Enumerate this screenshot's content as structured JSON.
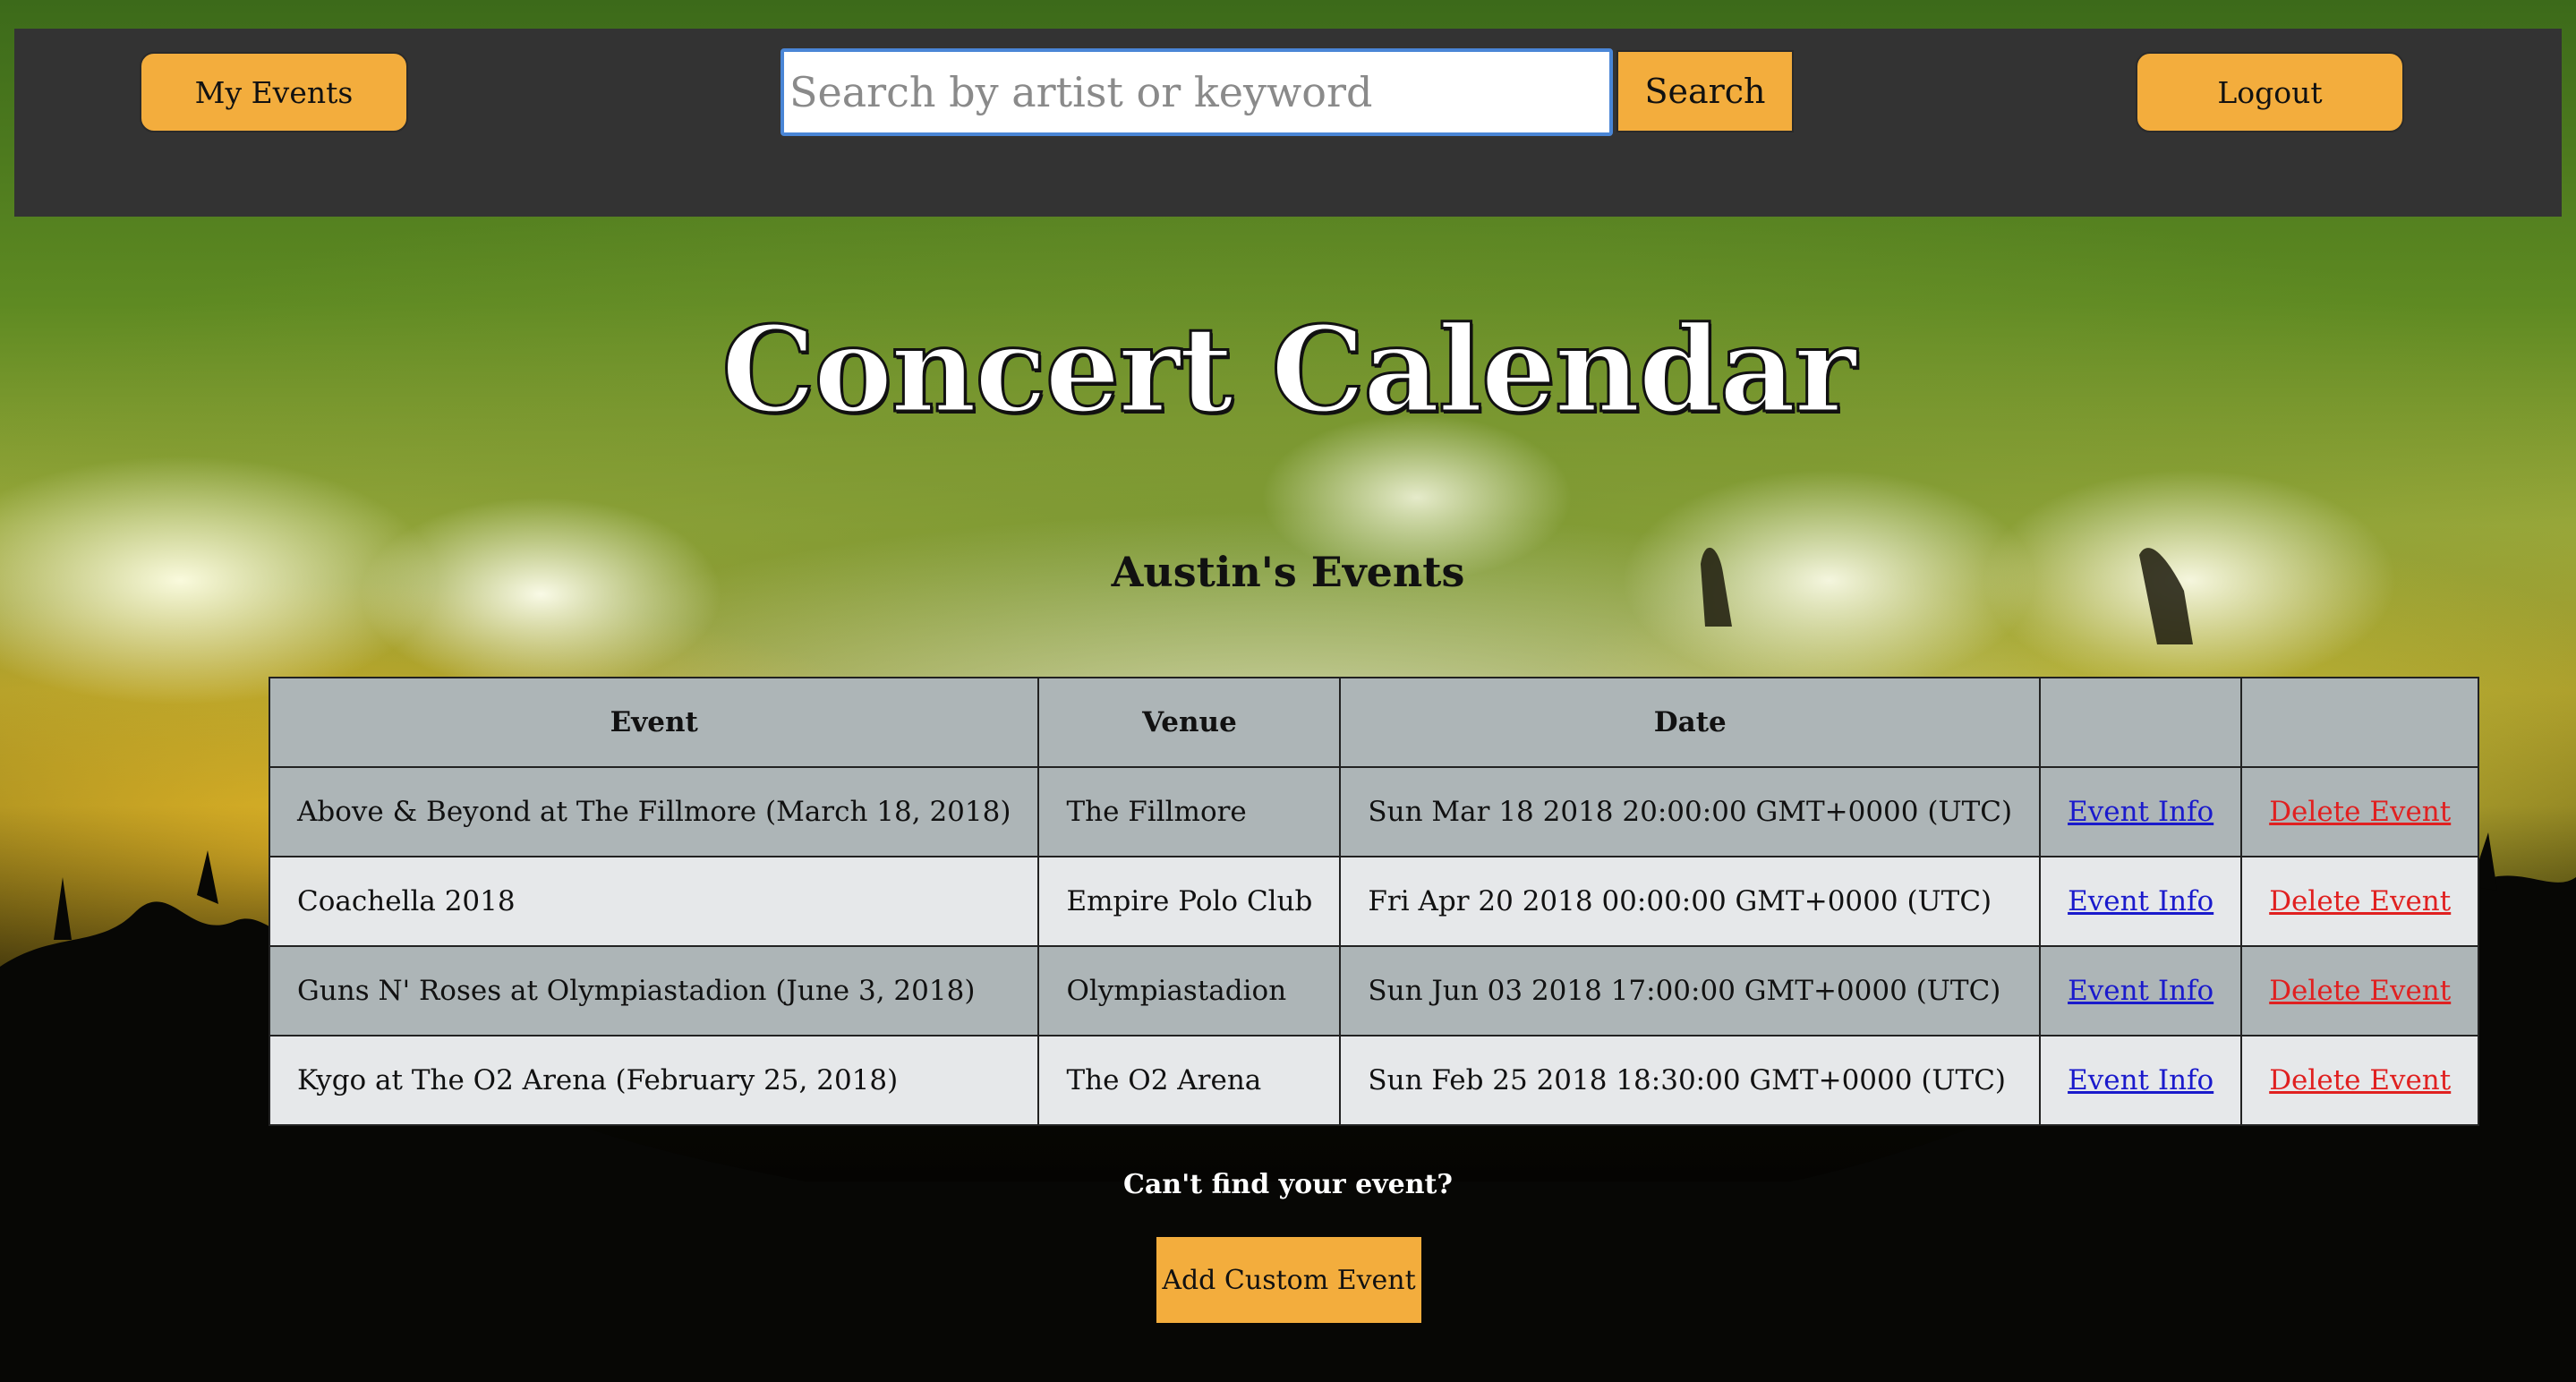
{
  "nav": {
    "my_events_label": "My Events",
    "search_placeholder": "Search by artist or keyword",
    "search_value": "",
    "search_button_label": "Search",
    "logout_label": "Logout"
  },
  "hero": {
    "title": "Concert Calendar",
    "subtitle": "Austin's Events"
  },
  "table": {
    "headers": [
      "Event",
      "Venue",
      "Date",
      "",
      ""
    ],
    "rows": [
      {
        "event": "Above & Beyond at The Fillmore (March 18, 2018)",
        "venue": "The Fillmore",
        "date": "Sun Mar 18 2018 20:00:00 GMT+0000 (UTC)",
        "info_label": "Event Info",
        "delete_label": "Delete Event"
      },
      {
        "event": "Coachella 2018",
        "venue": "Empire Polo Club",
        "date": "Fri Apr 20 2018 00:00:00 GMT+0000 (UTC)",
        "info_label": "Event Info",
        "delete_label": "Delete Event"
      },
      {
        "event": "Guns N' Roses at Olympiastadion (June 3, 2018)",
        "venue": "Olympiastadion",
        "date": "Sun Jun 03 2018 17:00:00 GMT+0000 (UTC)",
        "info_label": "Event Info",
        "delete_label": "Delete Event"
      },
      {
        "event": "Kygo at The O2 Arena (February 25, 2018)",
        "venue": "The O2 Arena",
        "date": "Sun Feb 25 2018 18:30:00 GMT+0000 (UTC)",
        "info_label": "Event Info",
        "delete_label": "Delete Event"
      }
    ]
  },
  "footer": {
    "cant_find_text": "Can't find your event?",
    "add_custom_label": "Add Custom Event"
  },
  "colors": {
    "accent": "#f3ad3d",
    "navbar": "#333333",
    "table_header": "#adb5b7",
    "table_alt_row": "#e6e8ea",
    "link_info": "#1a1acc",
    "link_delete": "#e02020"
  }
}
